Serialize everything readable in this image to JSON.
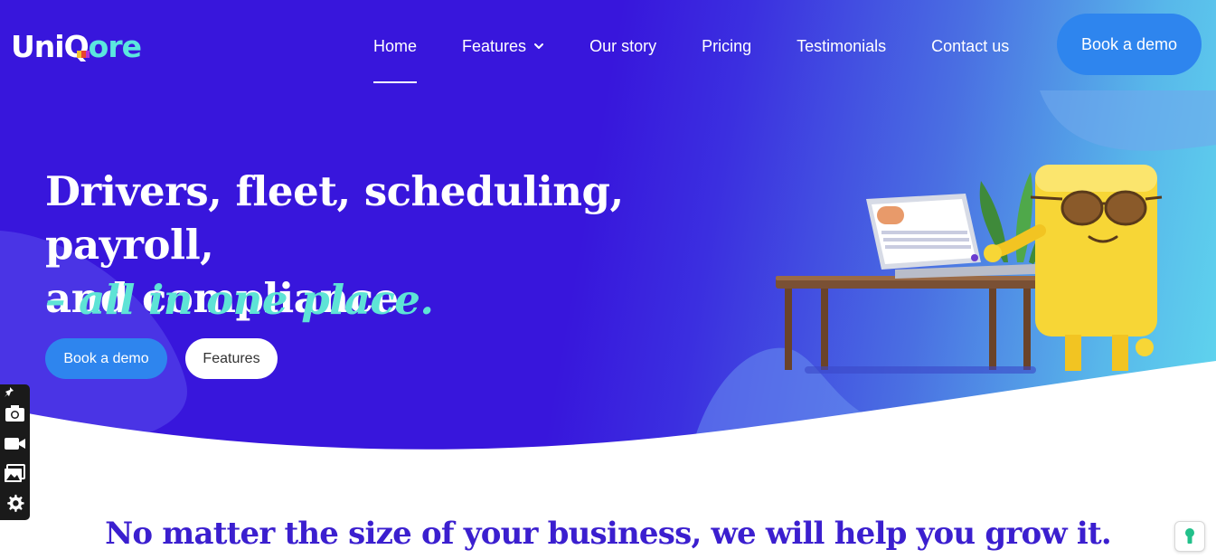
{
  "brand": {
    "name_part1": "Uni",
    "name_q": "Q",
    "name_part2": "ore"
  },
  "nav": {
    "items": [
      {
        "label": "Home",
        "active": true
      },
      {
        "label": "Features",
        "has_dropdown": true
      },
      {
        "label": "Our story"
      },
      {
        "label": "Pricing"
      },
      {
        "label": "Testimonials"
      },
      {
        "label": "Contact us"
      }
    ],
    "cta_label": "Book a demo"
  },
  "hero": {
    "headline_line1": "Drivers, fleet, scheduling, payroll,",
    "headline_line2": "and compliance",
    "headline_accent": "– all in one place.",
    "primary_button": "Book a demo",
    "secondary_button": "Features"
  },
  "tagline": "No matter the size of your business, we will help you grow it.",
  "toolbar": {
    "icons": [
      "pin-icon",
      "camera-icon",
      "video-icon",
      "gallery-icon",
      "gear-icon"
    ]
  },
  "colors": {
    "hero_bg": "#3816dc",
    "accent_teal": "#5ee3d6",
    "button_blue": "#2e85ee",
    "tagline_purple": "#3b1fcf"
  }
}
